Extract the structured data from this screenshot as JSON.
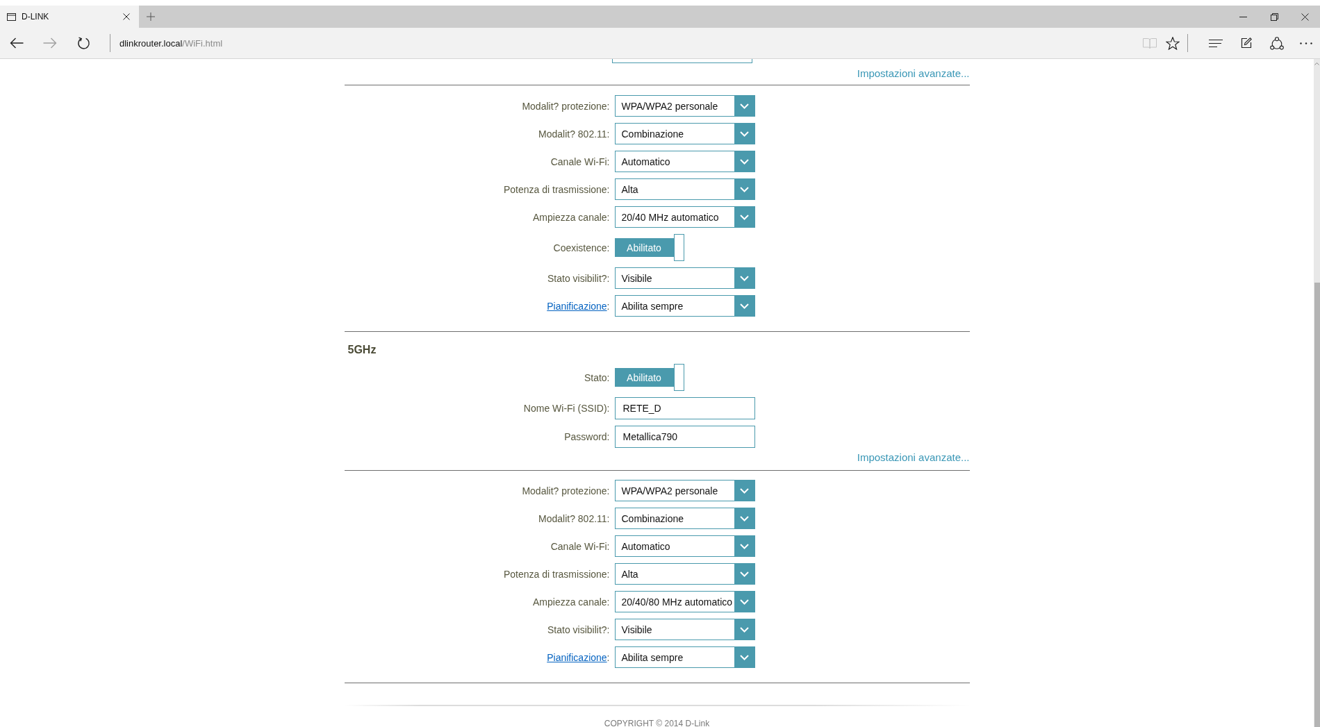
{
  "browser": {
    "tabs": [
      {
        "title": "D-LINK",
        "selected": true
      }
    ],
    "nav": {
      "back_disabled": false,
      "forward_disabled": true,
      "reading_view_disabled": true
    },
    "address": {
      "host": "dlinkrouter.local",
      "path": "/WiFi.html"
    }
  },
  "band_24ghz": {
    "advanced_link": "Impostazioni avanzate...",
    "settings": [
      {
        "kind": "select",
        "label": "Modalit? protezione:",
        "value": "WPA/WPA2 personale"
      },
      {
        "kind": "select",
        "label": "Modalit? 802.11:",
        "value": "Combinazione"
      },
      {
        "kind": "select",
        "label": "Canale Wi-Fi:",
        "value": "Automatico"
      },
      {
        "kind": "select",
        "label": "Potenza di trasmissione:",
        "value": "Alta"
      },
      {
        "kind": "select",
        "label": "Ampiezza canale:",
        "value": "20/40 MHz automatico"
      },
      {
        "kind": "toggle",
        "label": "Coexistence:",
        "value": "Abilitato",
        "on": true
      },
      {
        "kind": "select",
        "label": "Stato visibilit?:",
        "value": "Visibile"
      },
      {
        "kind": "select",
        "label": "Pianificazione",
        "label_link": true,
        "label_suffix": ":",
        "value": "Abilita sempre"
      }
    ]
  },
  "band_5ghz": {
    "title": "5GHz",
    "basic": [
      {
        "kind": "toggle",
        "label": "Stato:",
        "value": "Abilitato",
        "on": true
      },
      {
        "kind": "text",
        "label": "Nome Wi-Fi (SSID):",
        "value": "RETE_D"
      },
      {
        "kind": "text",
        "label": "Password:",
        "value": "Metallica790"
      }
    ],
    "advanced_link": "Impostazioni avanzate...",
    "settings": [
      {
        "kind": "select",
        "label": "Modalit? protezione:",
        "value": "WPA/WPA2 personale"
      },
      {
        "kind": "select",
        "label": "Modalit? 802.11:",
        "value": "Combinazione"
      },
      {
        "kind": "select",
        "label": "Canale Wi-Fi:",
        "value": "Automatico"
      },
      {
        "kind": "select",
        "label": "Potenza di trasmissione:",
        "value": "Alta"
      },
      {
        "kind": "select",
        "label": "Ampiezza canale:",
        "value": "20/40/80 MHz automatico"
      },
      {
        "kind": "select",
        "label": "Stato visibilit?:",
        "value": "Visibile"
      },
      {
        "kind": "select",
        "label": "Pianificazione",
        "label_link": true,
        "label_suffix": ":",
        "value": "Abilita sempre"
      }
    ]
  },
  "footer": {
    "copyright": "COPYRIGHT © 2014 D-Link"
  }
}
